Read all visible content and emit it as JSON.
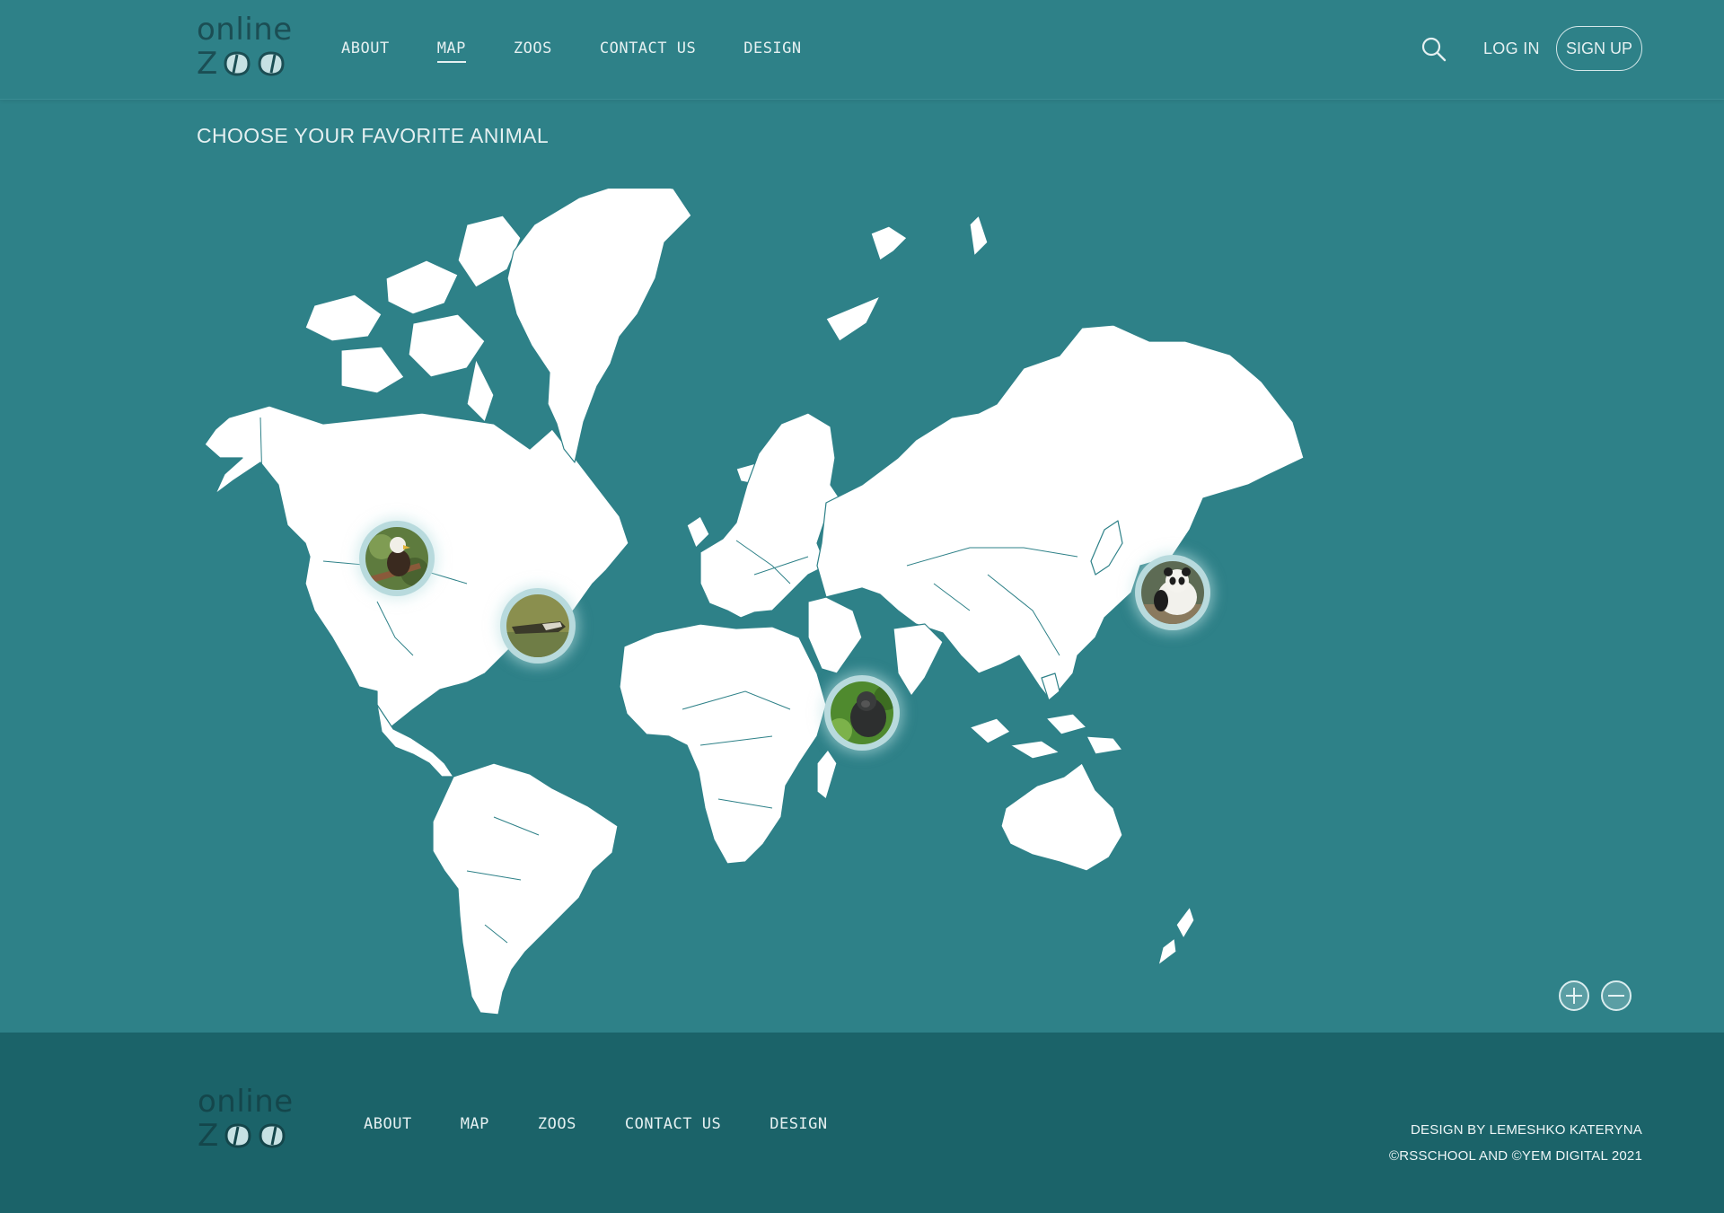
{
  "brand": {
    "line1": "online",
    "line2": "Z"
  },
  "nav": [
    {
      "label": "ABOUT",
      "active": false
    },
    {
      "label": "MAP",
      "active": true
    },
    {
      "label": "ZOOS",
      "active": false
    },
    {
      "label": "CONTACT US",
      "active": false
    },
    {
      "label": "DESIGN",
      "active": false
    }
  ],
  "header": {
    "search_icon": "search-icon",
    "login_label": "LOG IN",
    "signup_label": "SIGN UP"
  },
  "page": {
    "title": "CHOOSE YOUR FAVORITE ANIMAL"
  },
  "map": {
    "pins": [
      {
        "animal": "eagle",
        "icon": "eagle-photo"
      },
      {
        "animal": "alligator",
        "icon": "alligator-photo"
      },
      {
        "animal": "gorilla",
        "icon": "gorilla-photo"
      },
      {
        "animal": "panda",
        "icon": "panda-photo"
      }
    ],
    "controls": {
      "zoom_in_icon": "plus-circle-icon",
      "zoom_out_icon": "minus-circle-icon"
    }
  },
  "footer": {
    "nav": [
      "ABOUT",
      "MAP",
      "ZOOS",
      "CONTACT US",
      "DESIGN"
    ],
    "credit1": "DESIGN BY LEMESHKO KATERYNA",
    "credit2": "©RSSCHOOL AND ©YEM DIGITAL 2021"
  },
  "colors": {
    "background": "#2e8188",
    "footer": "#1b6369",
    "land": "#ffffff",
    "logo": "#1b4e54"
  }
}
